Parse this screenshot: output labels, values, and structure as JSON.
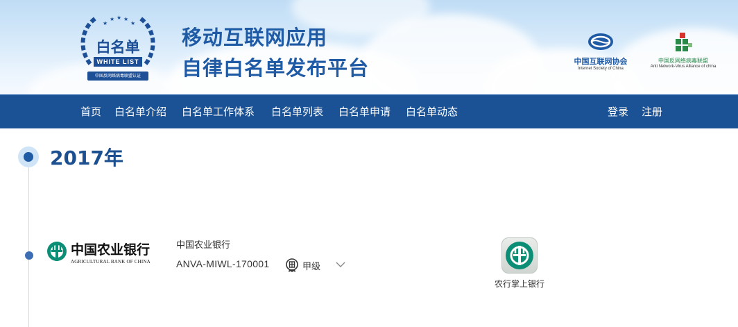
{
  "banner": {
    "badge": {
      "title": "白名单",
      "subtitle": "WHITE LIST",
      "ribbon": "中国反网络病毒联盟认证"
    },
    "site_title_line1": "移动互联网应用",
    "site_title_line2": "自律白名单发布平台",
    "partners": [
      {
        "name_cn": "中国互联网协会",
        "name_en": "Internet Society of China"
      },
      {
        "name_cn": "中国反网络病毒联盟",
        "name_en": "Anti Network-Virus Alliance of china"
      }
    ]
  },
  "nav": {
    "items": [
      "首页",
      "白名单介绍",
      "白名单工作体系",
      "白名单列表",
      "白名单申请",
      "白名单动态"
    ],
    "login": "登录",
    "register": "注册"
  },
  "timeline": {
    "year": "2017年",
    "entries": [
      {
        "logo_cn": "中国农业银行",
        "logo_en": "AGRICULTURAL BANK OF CHINA",
        "company": "中国农业银行",
        "whitelist_id": "ANVA-MIWL-170001",
        "level": "甲级",
        "app_name": "农行掌上银行"
      }
    ]
  },
  "colors": {
    "nav_bg": "#1b5296",
    "title_blue": "#1f5aa5",
    "year_blue": "#1b4f8f",
    "abc_green": "#0c8e76"
  }
}
